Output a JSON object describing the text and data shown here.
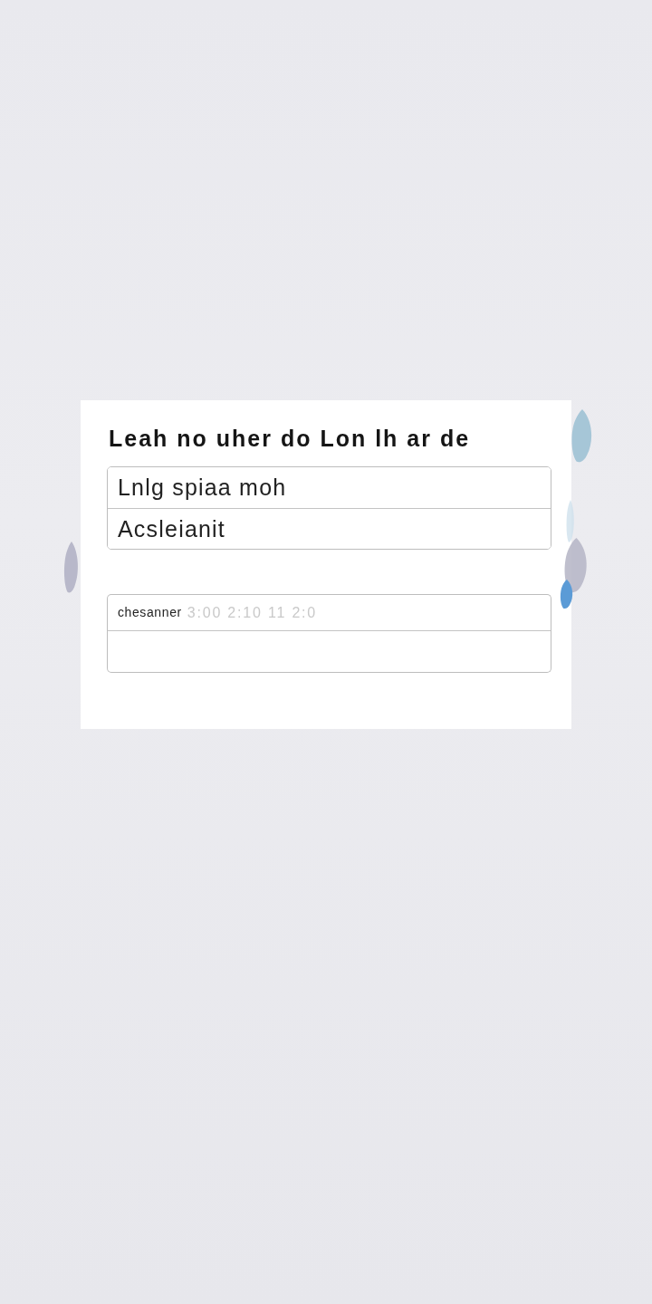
{
  "dialog": {
    "title": "Leah no uher do Lon lh ar de"
  },
  "options": [
    {
      "label": "Lnlg spiaa moh"
    },
    {
      "label": "Acsleianit"
    }
  ],
  "form": {
    "fields": [
      {
        "kind": "labeled",
        "label": "chesanner",
        "placeholder": "3:00 2:10 11 2:0"
      },
      {
        "kind": "blank"
      }
    ]
  }
}
